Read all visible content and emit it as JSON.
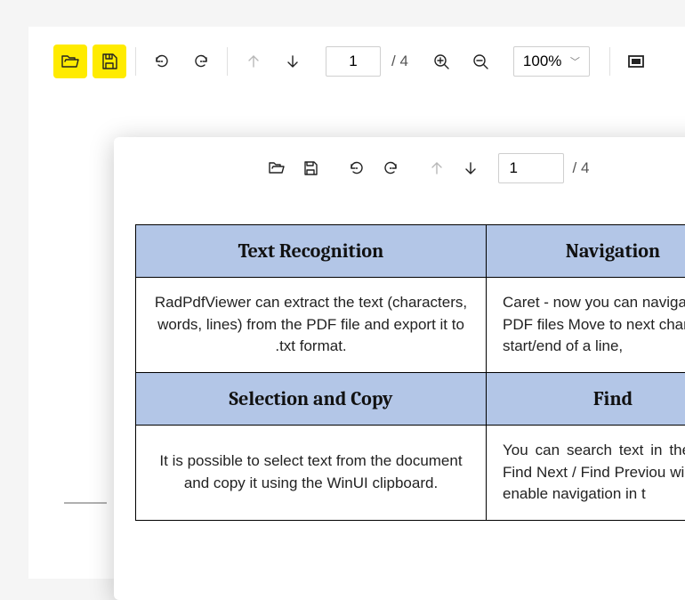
{
  "outerToolbar": {
    "pageCurrent": "1",
    "pageTotal": "/ 4",
    "zoom": "100%"
  },
  "insetToolbar": {
    "pageCurrent": "1",
    "pageTotal": "/ 4"
  },
  "table": {
    "rows": [
      {
        "header1": "Text Recognition",
        "header2": "Navigation"
      },
      {
        "cell1": "RadPdfViewer can extract the text (characters, words, lines) from the PDF file and export it to .txt format.",
        "cell2": "Caret - now you can navigate PDF files Move to next char start/end of a line,"
      },
      {
        "header1": "Selection and Copy",
        "header2": "Find"
      },
      {
        "cell1": "It is possible to select text from the document and copy it using the WinUI clipboard.",
        "cell2": "You can search text in the The Find Next / Find Previou will also enable navigation in t"
      }
    ]
  }
}
